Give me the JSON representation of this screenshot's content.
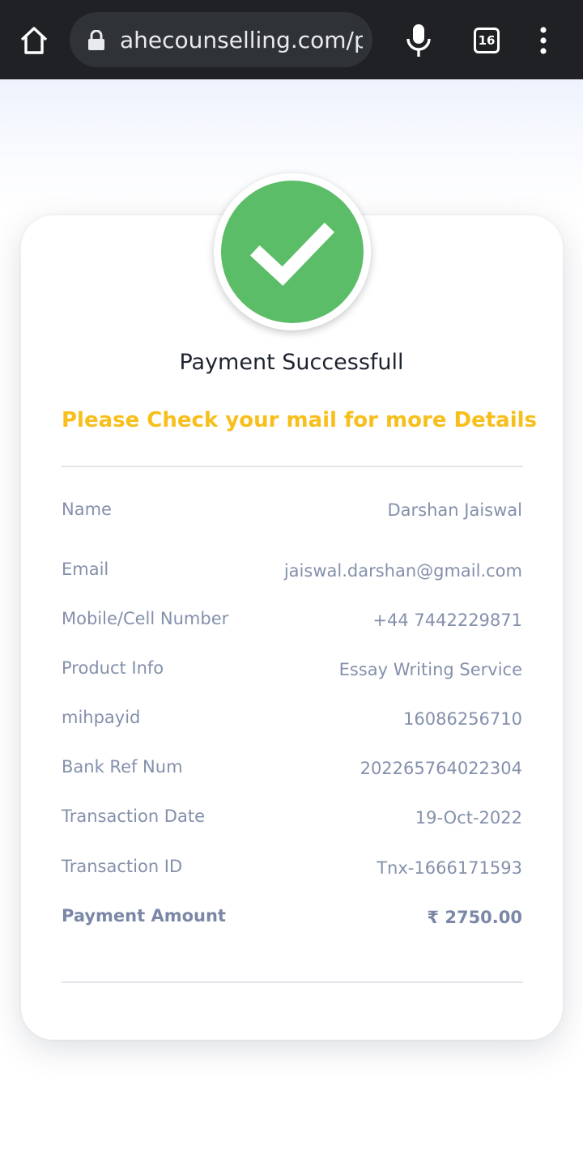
{
  "browser": {
    "url": "ahecounselling.com/p",
    "tab_count": "16",
    "icons": [
      "home-icon",
      "lock-icon",
      "mic-icon",
      "tabs-icon",
      "menu-dots-icon"
    ]
  },
  "status": {
    "icon": "check-icon",
    "title": "Payment Successfull",
    "message": "Please Check your mail for more Details"
  },
  "details": [
    {
      "label": "Name",
      "value": "Darshan Jaiswal"
    },
    {
      "label": "Email",
      "value": "jaiswal.darshan@gmail.com"
    },
    {
      "label": "Mobile/Cell Number",
      "value": "+44 7442229871"
    },
    {
      "label": "Product Info",
      "value": "Essay Writing Service"
    },
    {
      "label": "mihpayid",
      "value": "16086256710"
    },
    {
      "label": "Bank Ref Num",
      "value": "202265764022304"
    },
    {
      "label": "Transaction Date",
      "value": "19-Oct-2022"
    },
    {
      "label": "Transaction ID",
      "value": "Tnx-1666171593"
    },
    {
      "label": "Payment Amount",
      "value": "₹ 2750.00"
    }
  ],
  "colors": {
    "success_green": "#5cbd68",
    "accent_yellow": "#f7bf1b",
    "label_gray": "#8490ab",
    "browser_bar": "#1f2124"
  }
}
